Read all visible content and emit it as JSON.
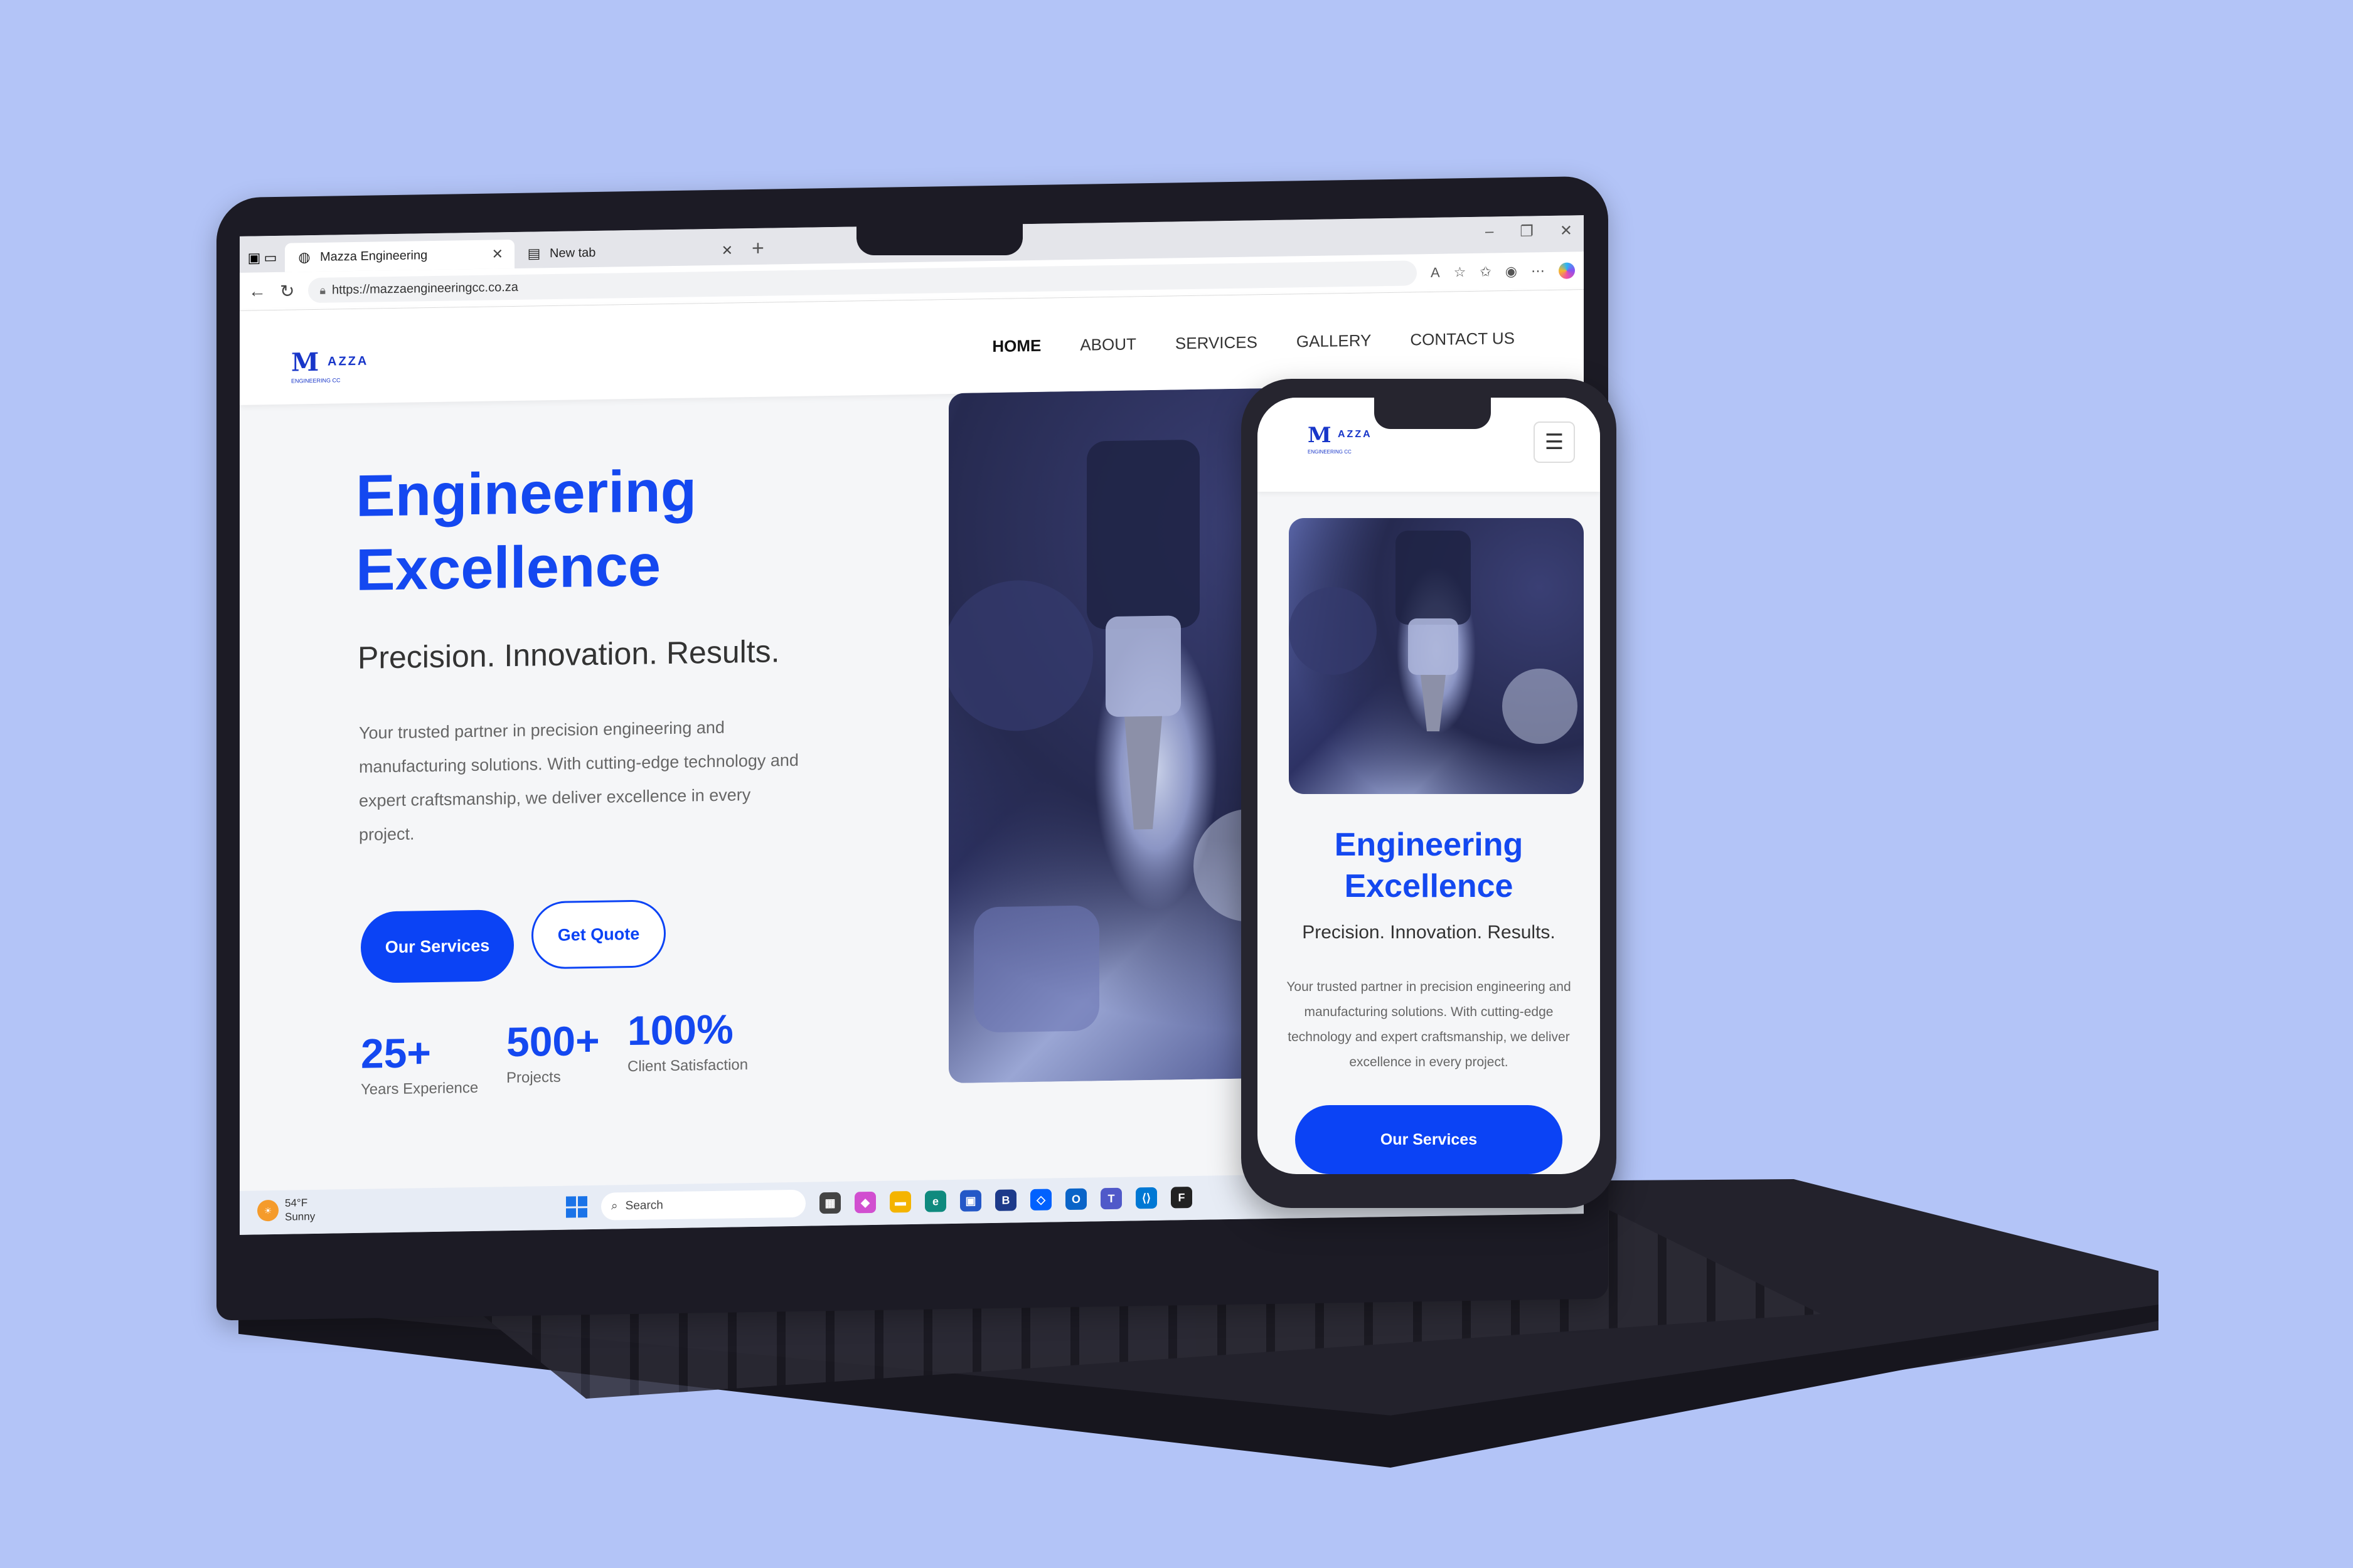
{
  "browser": {
    "tabs": [
      {
        "label": "Mazza Engineering",
        "icon": "globe-icon",
        "active": true
      },
      {
        "label": "New tab",
        "icon": "page-icon",
        "active": false
      }
    ],
    "url": "https://mazzaengineeringcc.co.za"
  },
  "site": {
    "logo": {
      "mark": "M",
      "word": "AZZA",
      "sub": "ENGINEERING CC"
    },
    "nav": [
      "HOME",
      "ABOUT",
      "SERVICES",
      "GALLERY",
      "CONTACT US"
    ],
    "hero": {
      "title_line1": "Engineering",
      "title_line2": "Excellence",
      "tagline": "Precision. Innovation. Results.",
      "description": "Your trusted partner in precision engineering and manufacturing solutions. With cutting-edge technology and expert craftsmanship, we deliver excellence in every project.",
      "primary_button": "Our Services",
      "secondary_button": "Get Quote"
    },
    "stats": [
      {
        "value": "25+",
        "label": "Years Experience"
      },
      {
        "value": "500+",
        "label": "Projects"
      },
      {
        "value": "100%",
        "label": "Client Satisfaction"
      }
    ]
  },
  "taskbar": {
    "weather_temp": "54°F",
    "weather_desc": "Sunny",
    "search_placeholder": "Search"
  },
  "phone": {
    "title_line1": "Engineering",
    "title_line2": "Excellence",
    "tagline": "Precision. Innovation. Results.",
    "description": "Your trusted partner in precision engineering and manufacturing solutions. With cutting-edge technology and expert craftsmanship, we deliver excellence in every project.",
    "button": "Our Services"
  },
  "colors": {
    "background": "#b3c4f7",
    "accent": "#0b43f5",
    "device": "#1c1b25"
  }
}
